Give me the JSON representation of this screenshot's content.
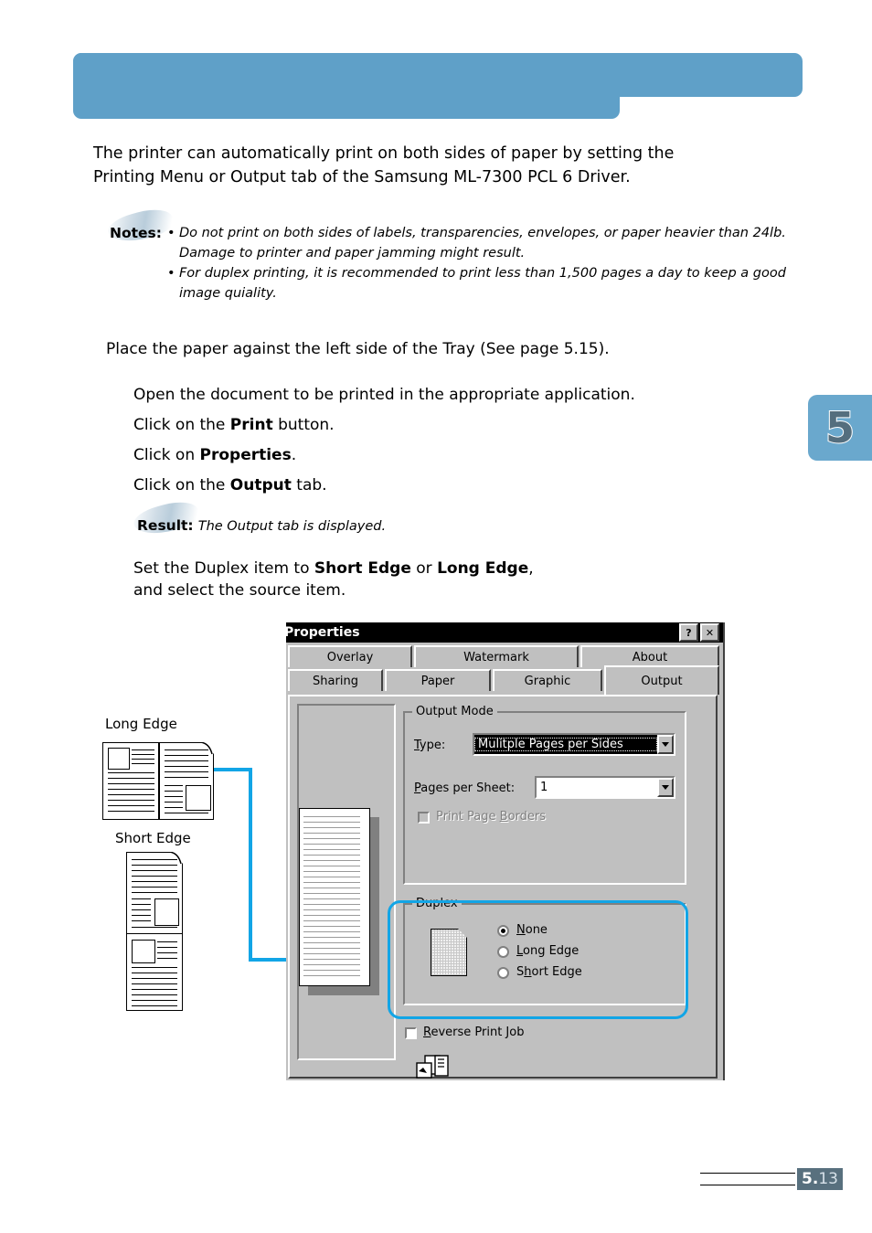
{
  "document": {
    "intro_line1": "The printer can automatically print on both sides of paper by setting the",
    "intro_line2": "Printing Menu or Output tab of the Samsung ML-7300 PCL 6 Driver.",
    "notes_label": "Notes:",
    "notes": [
      "Do not print on both sides of labels, transparencies, envelopes, or paper heavier than 24lb. Damage to printer and paper jamming might result.",
      "For duplex printing, it is recommended to print less than 1,500 pages a day to keep a good image quiality."
    ],
    "notes_bullet": "•",
    "place_line": "Place the paper against the left side of the Tray (See page 5.15).",
    "steps": [
      "Open the document to be printed in the appropriate application.",
      "Click on the Print button.",
      "Click on Properties.",
      "Click on the Output tab."
    ],
    "result_label": "Result:",
    "result_text": "The Output tab is displayed.",
    "final_step_line1": "Set the Duplex item to Short Edge or Long Edge,",
    "final_step_line2": "and select the source item.",
    "chapter_number": "5",
    "page_number_major": "5.",
    "page_number_minor": "13"
  },
  "illustration": {
    "long_edge_label": "Long Edge",
    "short_edge_label": "Short Edge"
  },
  "dialog": {
    "title": "Properties",
    "help_button": "?",
    "close_button": "✕",
    "tabs_row1": [
      "Overlay",
      "Watermark",
      "About"
    ],
    "tabs_row2": [
      "Sharing",
      "Paper",
      "Graphic",
      "Output"
    ],
    "active_tab": "Output",
    "output_mode": {
      "group_label": "Output Mode",
      "type_label": "Type:",
      "type_value": "Mulitple Pages per Sides",
      "pages_per_sheet_label": "Pages per Sheet:",
      "pages_per_sheet_value": "1",
      "print_page_borders_label": "Print Page Borders",
      "print_page_borders_checked": false
    },
    "duplex": {
      "group_label": "Duplex",
      "options": [
        "None",
        "Long Edge",
        "Short Edge"
      ],
      "selected": "None"
    },
    "reverse_print_job_label": "Reverse Print Job",
    "reverse_print_job_checked": false
  },
  "colors": {
    "banner_blue": "#5fa0c8",
    "accent_blue": "#12a5e6",
    "chapter_tab_blue": "#6aa8cd",
    "page_badge_slate": "#58707e",
    "dialog_face": "#c0c0c0"
  }
}
